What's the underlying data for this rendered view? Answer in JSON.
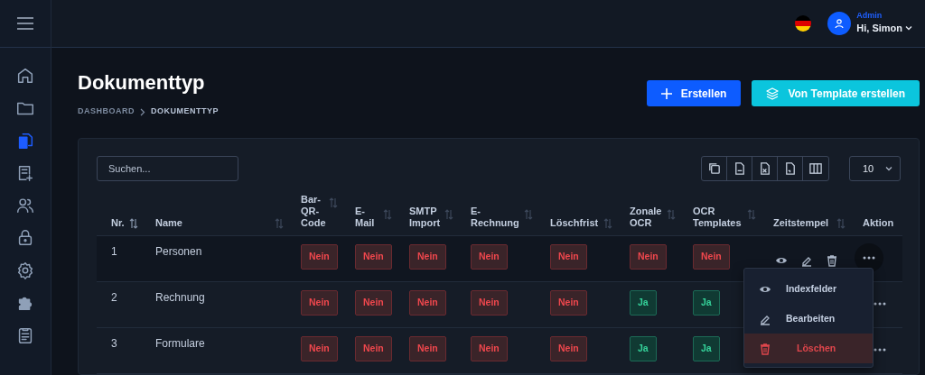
{
  "sidebar": {
    "items": [
      {
        "selected": false
      },
      {
        "selected": false
      },
      {
        "selected": true
      },
      {
        "selected": false
      },
      {
        "selected": false
      },
      {
        "selected": false
      },
      {
        "selected": false
      },
      {
        "selected": false
      },
      {
        "selected": false
      }
    ]
  },
  "user": {
    "role": "Admin",
    "greeting": "Hi, Simon"
  },
  "page": {
    "title": "Dokumenttyp",
    "breadcrumb": [
      "DASHBOARD",
      "DOKUMENTTYP"
    ]
  },
  "actions": [
    {
      "kind": "primary",
      "label": "Erstellen"
    },
    {
      "kind": "info",
      "label": "Von Template erstellen"
    }
  ],
  "search": {
    "placeholder": "Suchen..."
  },
  "page_size": "10",
  "table": {
    "columns": [
      "Nr.",
      "Name",
      "Bar-QR-Code",
      "E-Mail",
      "SMTP Import",
      "E-Rechnung",
      "Löschfrist",
      "Zonale OCR",
      "OCR Templates",
      "Zeitstempel",
      "Aktion"
    ],
    "rows": [
      {
        "nr": "1",
        "name": "Personen",
        "hovered": true,
        "flags": [
          {
            "label": "Nein",
            "yes": false
          },
          {
            "label": "Nein",
            "yes": false
          },
          {
            "label": "Nein",
            "yes": false
          },
          {
            "label": "Nein",
            "yes": false
          },
          {
            "label": "Nein",
            "yes": false
          },
          {
            "label": "Nein",
            "yes": false
          },
          {
            "label": "Nein",
            "yes": false
          }
        ]
      },
      {
        "nr": "2",
        "name": "Rechnung",
        "hovered": false,
        "flags": [
          {
            "label": "Nein",
            "yes": false
          },
          {
            "label": "Nein",
            "yes": false
          },
          {
            "label": "Nein",
            "yes": false
          },
          {
            "label": "Nein",
            "yes": false
          },
          {
            "label": "Nein",
            "yes": false
          },
          {
            "label": "Ja",
            "yes": true
          },
          {
            "label": "Ja",
            "yes": true
          }
        ]
      },
      {
        "nr": "3",
        "name": "Formulare",
        "hovered": false,
        "flags": [
          {
            "label": "Nein",
            "yes": false
          },
          {
            "label": "Nein",
            "yes": false
          },
          {
            "label": "Nein",
            "yes": false
          },
          {
            "label": "Nein",
            "yes": false
          },
          {
            "label": "Nein",
            "yes": false
          },
          {
            "label": "Ja",
            "yes": true
          },
          {
            "label": "Ja",
            "yes": true
          }
        ]
      }
    ]
  },
  "action_menu": {
    "items": [
      {
        "label": "Indexfelder",
        "danger": false,
        "selected": false
      },
      {
        "label": "Bearbeiten",
        "danger": false,
        "selected": false
      },
      {
        "label": "Löschen",
        "danger": true,
        "selected": true
      }
    ]
  }
}
